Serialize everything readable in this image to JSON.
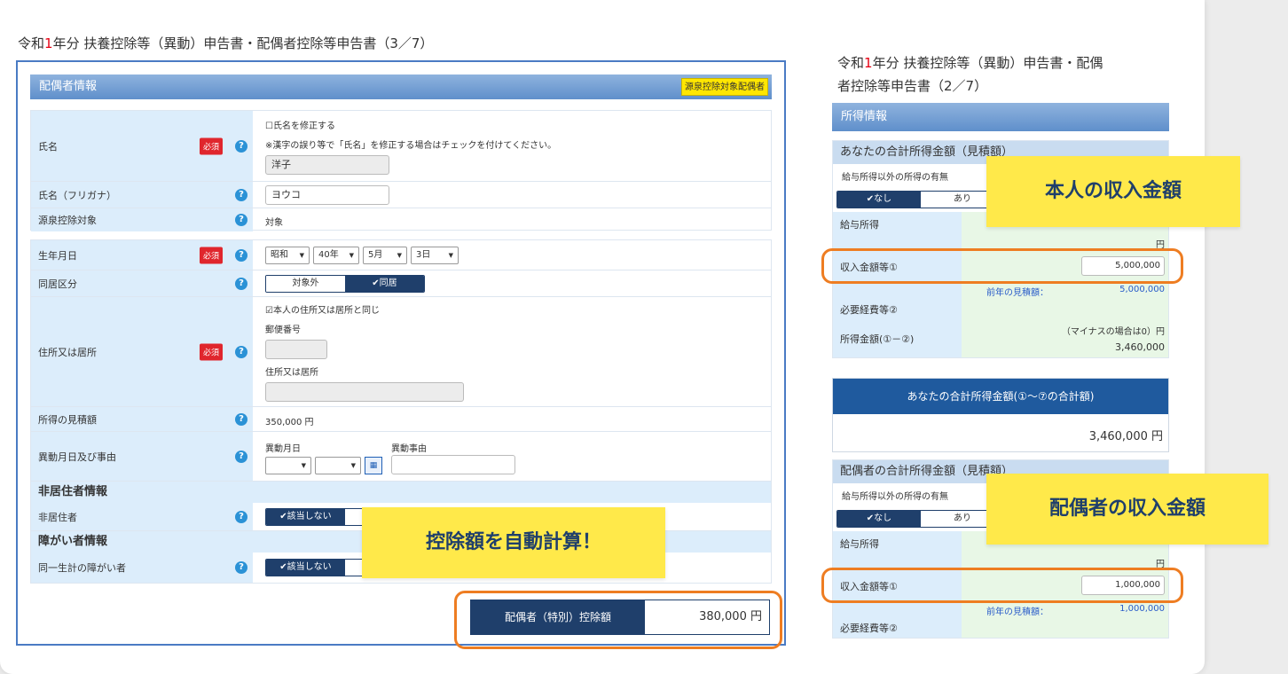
{
  "left": {
    "title_pre": "令和",
    "title_num": "1",
    "title_post": "年分 扶養控除等（異動）申告書・配偶者控除等申告書（3／7）",
    "header": "配偶者情報",
    "badge": "源泉控除対象配偶者",
    "name_label": "氏名",
    "required": "必須",
    "help": "?",
    "name_fix_checkbox": "☐氏名を修正する",
    "name_note": "※漢字の誤り等で「氏名」を修正する場合はチェックを付けてください。",
    "name_value": "洋子",
    "kana_label": "氏名（フリガナ）",
    "kana_value": "ヨウコ",
    "gensen_label": "源泉控除対象",
    "gensen_value": "対象",
    "birth_label": "生年月日",
    "birth_era": "昭和",
    "birth_year": "40年",
    "birth_month": "5月",
    "birth_day": "3日",
    "dokyo_label": "同居区分",
    "dokyo_off": "対象外",
    "dokyo_on": "✔同居",
    "address_label": "住所又は居所",
    "address_same": "☑本人の住所又は居所と同じ",
    "postal_label": "郵便番号",
    "address_sub": "住所又は居所",
    "income_est_label": "所得の見積額",
    "income_est_value": "350,000 円",
    "change_label": "異動月日及び事由",
    "change_date": "異動月日",
    "change_reason": "異動事由",
    "calendar_icon": "calendar-icon",
    "nonres_section": "非居住者情報",
    "nonres_label": "非居住者",
    "not_applicable": "✔該当しない",
    "disab_section": "障がい者情報",
    "disab_label": "同一生計の障がい者",
    "deduction_label": "配偶者（特別）控除額",
    "deduction_value": "380,000 円"
  },
  "right": {
    "title_pre": "令和",
    "title_num": "1",
    "title_line1_post": "年分 扶養控除等（異動）申告書・配偶",
    "title_line2": "者控除等申告書（2／7）",
    "header": "所得情報",
    "self_total_title": "あなたの合計所得金額（見積額）",
    "other_income": "給与所得以外の所得の有無",
    "none": "✔なし",
    "yes": "あり",
    "salary_label": "給与所得",
    "yen": "円",
    "income_label": "収入金額等①",
    "self_income": "5,000,000",
    "prev_label": "前年の見積額：",
    "self_prev": "5,000,000",
    "expense_label": "必要経費等②",
    "minus_note": "（マイナスの場合は0）円",
    "shotoku_label": "所得金額(①－②)",
    "self_shotoku": "3,460,000",
    "total_banner": "あなたの合計所得金額(①～⑦の合計額)",
    "total_value": "3,460,000 円",
    "spouse_total_title": "配偶者の合計所得金額（見積額）",
    "spouse_income": "1,000,000",
    "spouse_prev": "1,000,000"
  },
  "callouts": {
    "self_income": "本人の収入金額",
    "auto_calc": "控除額を自動計算！",
    "spouse_income": "配偶者の収入金額"
  }
}
